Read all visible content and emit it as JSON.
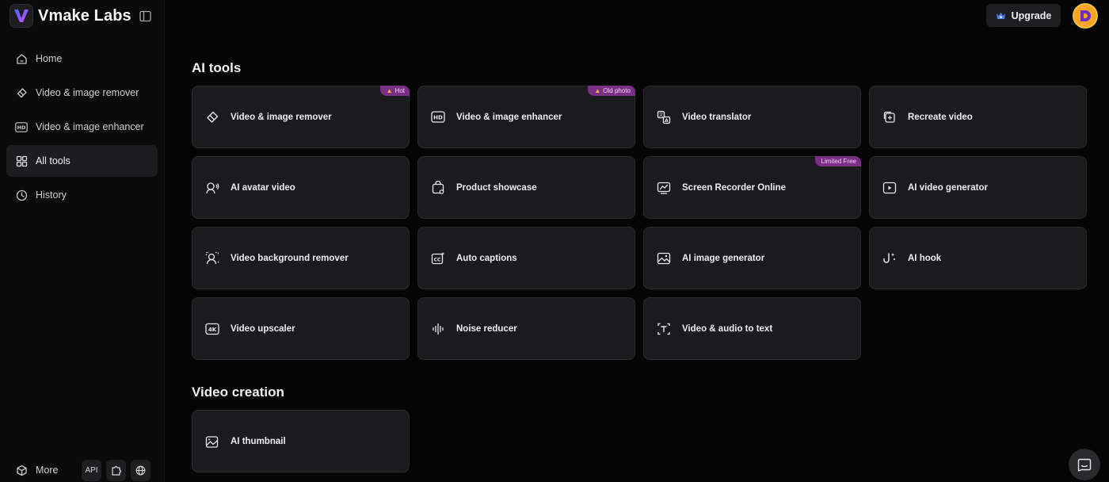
{
  "brand": {
    "name": "Vmake Labs"
  },
  "sidebar": {
    "items": [
      {
        "label": "Home",
        "icon": "home-icon"
      },
      {
        "label": "Video & image remover",
        "icon": "eraser-icon"
      },
      {
        "label": "Video & image enhancer",
        "icon": "hd-icon"
      },
      {
        "label": "All tools",
        "icon": "grid-icon",
        "active": true
      },
      {
        "label": "History",
        "icon": "clock-icon"
      }
    ],
    "more_label": "More",
    "api_label": "API"
  },
  "header": {
    "upgrade_label": "Upgrade",
    "avatar_initial": "D"
  },
  "sections": {
    "ai_tools": {
      "title": "AI tools",
      "cards": [
        {
          "label": "Video & image remover",
          "icon": "eraser-icon",
          "badge": "Hot"
        },
        {
          "label": "Video & image enhancer",
          "icon": "hd-icon",
          "badge": "Old photo"
        },
        {
          "label": "Video translator",
          "icon": "translate-icon"
        },
        {
          "label": "Recreate video",
          "icon": "recreate-icon"
        },
        {
          "label": "AI avatar video",
          "icon": "avatar-speak-icon"
        },
        {
          "label": "Product showcase",
          "icon": "product-bag-icon"
        },
        {
          "label": "Screen Recorder Online",
          "icon": "screen-recorder-icon",
          "badge": "Limited Free"
        },
        {
          "label": "AI video generator",
          "icon": "play-box-icon"
        },
        {
          "label": "Video background remover",
          "icon": "person-bg-icon"
        },
        {
          "label": "Auto captions",
          "icon": "cc-icon"
        },
        {
          "label": "AI image generator",
          "icon": "image-icon"
        },
        {
          "label": "AI hook",
          "icon": "hook-icon"
        },
        {
          "label": "Video upscaler",
          "icon": "4k-icon"
        },
        {
          "label": "Noise reducer",
          "icon": "waveform-icon"
        },
        {
          "label": "Video & audio to text",
          "icon": "text-cursor-icon"
        }
      ]
    },
    "video_creation": {
      "title": "Video creation",
      "cards": [
        {
          "label": "AI thumbnail",
          "icon": "thumbnail-icon"
        }
      ]
    }
  },
  "colors": {
    "accent_badge": "#7b2e86",
    "avatar": "#f2a623",
    "logo_gradient": [
      "#3f6bff",
      "#c64bff"
    ]
  }
}
